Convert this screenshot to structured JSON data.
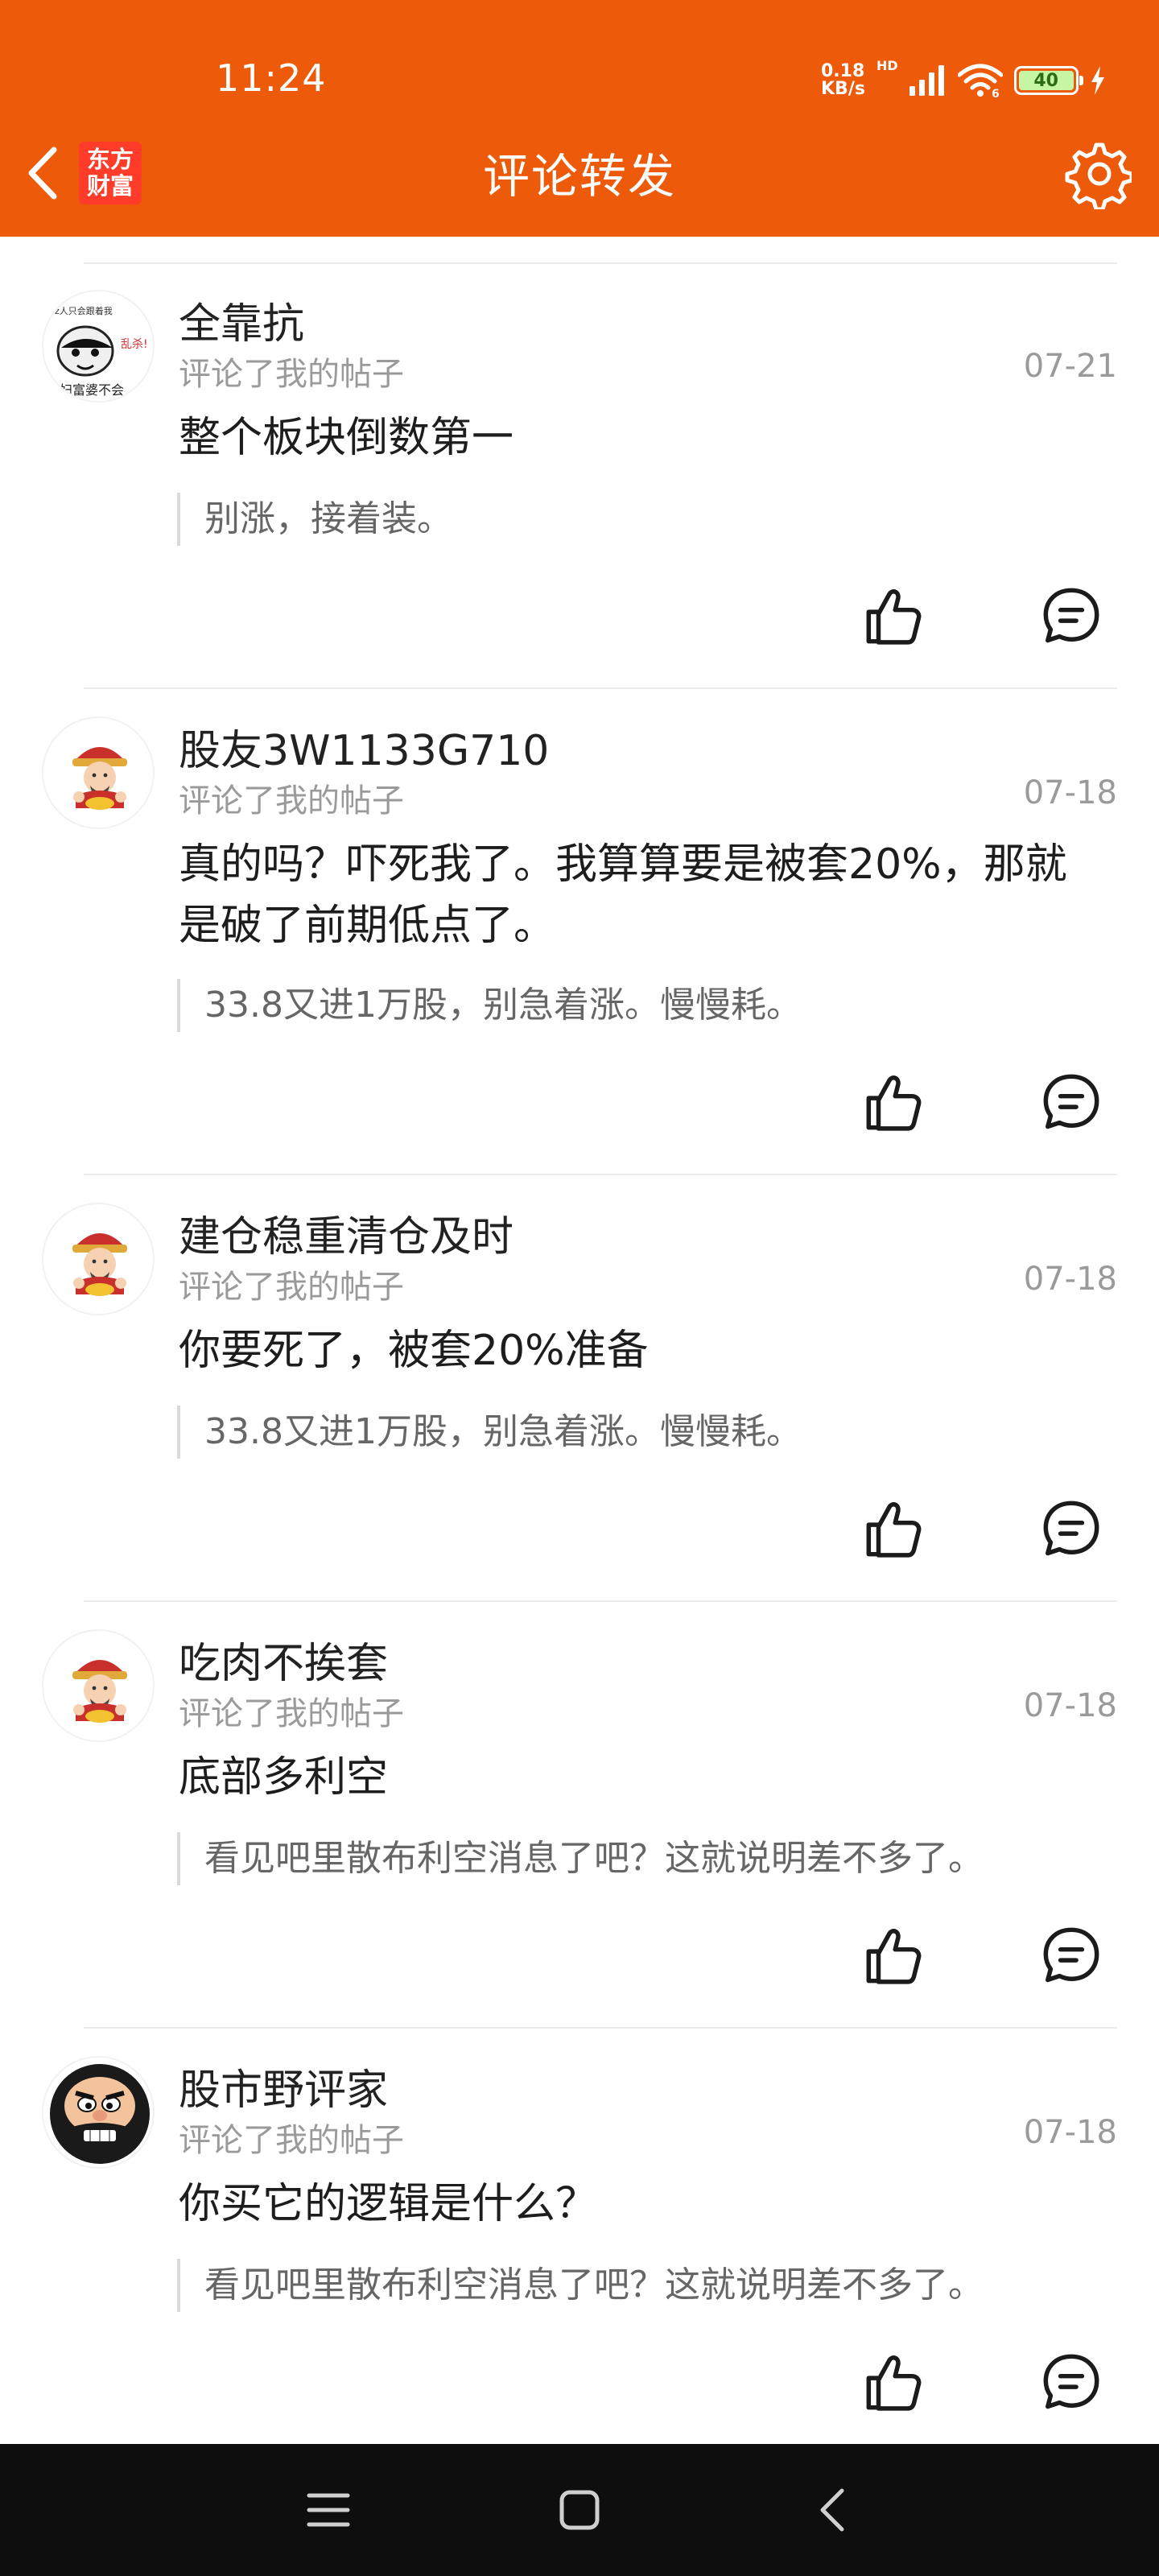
{
  "status_bar": {
    "time": "11:24",
    "net_speed_value": "0.18",
    "net_speed_unit": "KB/s",
    "hd_label": "HD",
    "battery": "40"
  },
  "header": {
    "logo_line1": "东方",
    "logo_line2": "财富",
    "title": "评论转发"
  },
  "colors": {
    "accent": "#ec5a0a",
    "muted_text": "#9a9a9a",
    "nav_bar": "#0e0e0e"
  },
  "icons": [
    "back-arrow-icon",
    "settings-gear-icon",
    "like-thumb-icon",
    "reply-bubble-icon",
    "menu-icon",
    "home-square-icon",
    "back-triangle-icon"
  ],
  "comments": [
    {
      "username": "全靠抗",
      "subtitle": "评论了我的帖子",
      "date": "07-21",
      "comment": "整个板块倒数第一",
      "quote": "别涨，接着装。",
      "avatar": "meme-face-avatar"
    },
    {
      "username": "股友3W1133G710",
      "subtitle": "评论了我的帖子",
      "date": "07-18",
      "comment": "真的吗？吓死我了。我算算要是被套20%，那就是破了前期低点了。",
      "quote": "33.8又进1万股，别急着涨。慢慢耗。",
      "avatar": "fortune-god-avatar"
    },
    {
      "username": "建仓稳重清仓及时",
      "subtitle": "评论了我的帖子",
      "date": "07-18",
      "comment": "你要死了，被套20%准备",
      "quote": "33.8又进1万股，别急着涨。慢慢耗。",
      "avatar": "fortune-god-avatar"
    },
    {
      "username": "吃肉不挨套",
      "subtitle": "评论了我的帖子",
      "date": "07-18",
      "comment": "底部多利空",
      "quote": "看见吧里散布利空消息了吧？这就说明差不多了。",
      "avatar": "fortune-god-avatar"
    },
    {
      "username": "股市野评家",
      "subtitle": "评论了我的帖子",
      "date": "07-18",
      "comment": "你买它的逻辑是什么？",
      "quote": "看见吧里散布利空消息了吧？这就说明差不多了。",
      "avatar": "cartoon-man-avatar"
    }
  ]
}
